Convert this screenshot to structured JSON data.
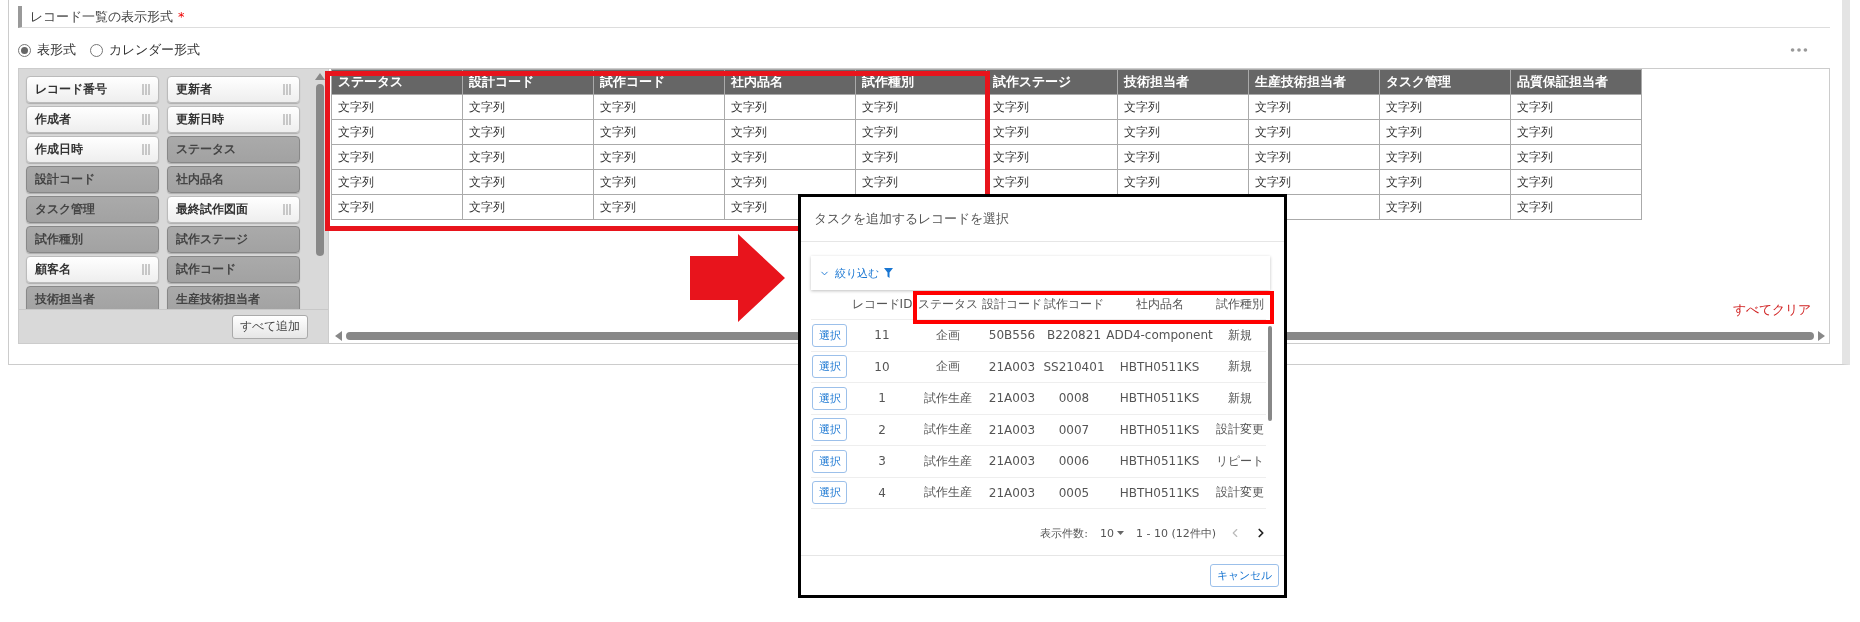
{
  "section": {
    "title": "レコード一覧の表示形式",
    "required_mark": "*"
  },
  "display_modes": [
    {
      "label": "表形式",
      "selected": true
    },
    {
      "label": "カレンダー形式",
      "selected": false
    }
  ],
  "field_list": {
    "items": [
      {
        "label": "レコード番号",
        "in_use": false
      },
      {
        "label": "更新者",
        "in_use": false
      },
      {
        "label": "作成者",
        "in_use": false
      },
      {
        "label": "更新日時",
        "in_use": false
      },
      {
        "label": "作成日時",
        "in_use": false
      },
      {
        "label": "ステータス",
        "in_use": true
      },
      {
        "label": "設計コード",
        "in_use": true
      },
      {
        "label": "社内品名",
        "in_use": true
      },
      {
        "label": "タスク管理",
        "in_use": true
      },
      {
        "label": "最終試作図面",
        "in_use": false
      },
      {
        "label": "試作種別",
        "in_use": true
      },
      {
        "label": "試作ステージ",
        "in_use": true
      },
      {
        "label": "顧客名",
        "in_use": false
      },
      {
        "label": "試作コード",
        "in_use": true
      },
      {
        "label": "技術担当者",
        "in_use": true
      },
      {
        "label": "生産技術担当者",
        "in_use": true
      }
    ],
    "add_all_button": "すべて追加"
  },
  "table": {
    "columns": [
      "ステータス",
      "設計コード",
      "試作コード",
      "社内品名",
      "試作種別",
      "試作ステージ",
      "技術担当者",
      "生産技術担当者",
      "タスク管理",
      "品質保証担当者"
    ],
    "rows": [
      [
        "文字列",
        "文字列",
        "文字列",
        "文字列",
        "文字列",
        "文字列",
        "文字列",
        "文字列",
        "文字列",
        "文字列"
      ],
      [
        "文字列",
        "文字列",
        "文字列",
        "文字列",
        "文字列",
        "文字列",
        "文字列",
        "文字列",
        "文字列",
        "文字列"
      ],
      [
        "文字列",
        "文字列",
        "文字列",
        "文字列",
        "文字列",
        "文字列",
        "文字列",
        "文字列",
        "文字列",
        "文字列"
      ],
      [
        "文字列",
        "文字列",
        "文字列",
        "文字列",
        "文字列",
        "文字列",
        "文字列",
        "文字列",
        "文字列",
        "文字列"
      ],
      [
        "文字列",
        "文字列",
        "文字列",
        "文字列",
        null,
        null,
        null,
        null,
        "文字列",
        "文字列"
      ]
    ]
  },
  "clear_all_link": "すべてクリア",
  "dialog": {
    "title": "タスクを追加するレコードを選択",
    "filter_label": "絞り込む",
    "columns": [
      "レコードID",
      "ステータス",
      "設計コード",
      "試作コード",
      "社内品名",
      "試作種別"
    ],
    "rows": [
      {
        "button": "選択",
        "cells": [
          "11",
          "企画",
          "50B556",
          "B220821",
          "ADD4-component",
          "新規"
        ]
      },
      {
        "button": "選択",
        "cells": [
          "10",
          "企画",
          "21A003",
          "SS210401",
          "HBTH0511KS",
          "新規"
        ]
      },
      {
        "button": "選択",
        "cells": [
          "1",
          "試作生産",
          "21A003",
          "0008",
          "HBTH0511KS",
          "新規"
        ]
      },
      {
        "button": "選択",
        "cells": [
          "2",
          "試作生産",
          "21A003",
          "0007",
          "HBTH0511KS",
          "設計変更"
        ]
      },
      {
        "button": "選択",
        "cells": [
          "3",
          "試作生産",
          "21A003",
          "0006",
          "HBTH0511KS",
          "リピート"
        ]
      },
      {
        "button": "選択",
        "cells": [
          "4",
          "試作生産",
          "21A003",
          "0005",
          "HBTH0511KS",
          "設計変更"
        ]
      }
    ],
    "pagination": {
      "label": "表示件数:",
      "per_page": "10",
      "range": "1 - 10 (12件中)",
      "prev_enabled": false,
      "next_enabled": true
    },
    "cancel_button": "キャンセル"
  }
}
